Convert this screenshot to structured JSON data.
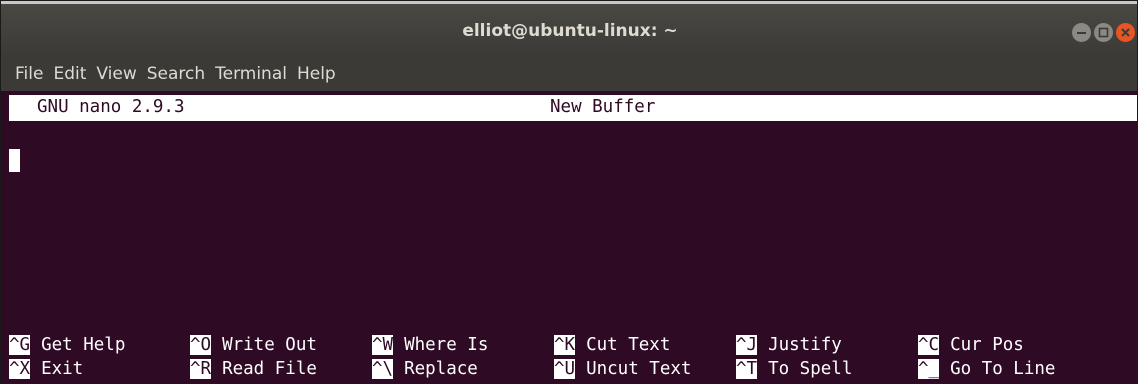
{
  "window": {
    "title": "elliot@ubuntu-linux: ~",
    "colors": {
      "terminal_bg": "#2f0a24",
      "titlebar_bg": "#3b3a36",
      "close_button": "#e95420",
      "text": "#ffffff"
    }
  },
  "menubar": {
    "items": [
      "File",
      "Edit",
      "View",
      "Search",
      "Terminal",
      "Help"
    ]
  },
  "nano": {
    "version_label": "GNU nano 2.9.3",
    "buffer_name": "New Buffer",
    "shortcuts": {
      "row1": [
        {
          "key": "^G",
          "label": "Get Help"
        },
        {
          "key": "^O",
          "label": "Write Out"
        },
        {
          "key": "^W",
          "label": "Where Is"
        },
        {
          "key": "^K",
          "label": "Cut Text"
        },
        {
          "key": "^J",
          "label": "Justify"
        },
        {
          "key": "^C",
          "label": "Cur Pos"
        }
      ],
      "row2": [
        {
          "key": "^X",
          "label": "Exit"
        },
        {
          "key": "^R",
          "label": "Read File"
        },
        {
          "key": "^\\",
          "label": "Replace"
        },
        {
          "key": "^U",
          "label": "Uncut Text"
        },
        {
          "key": "^T",
          "label": "To Spell"
        },
        {
          "key": "^_",
          "label": "Go To Line"
        }
      ]
    }
  }
}
